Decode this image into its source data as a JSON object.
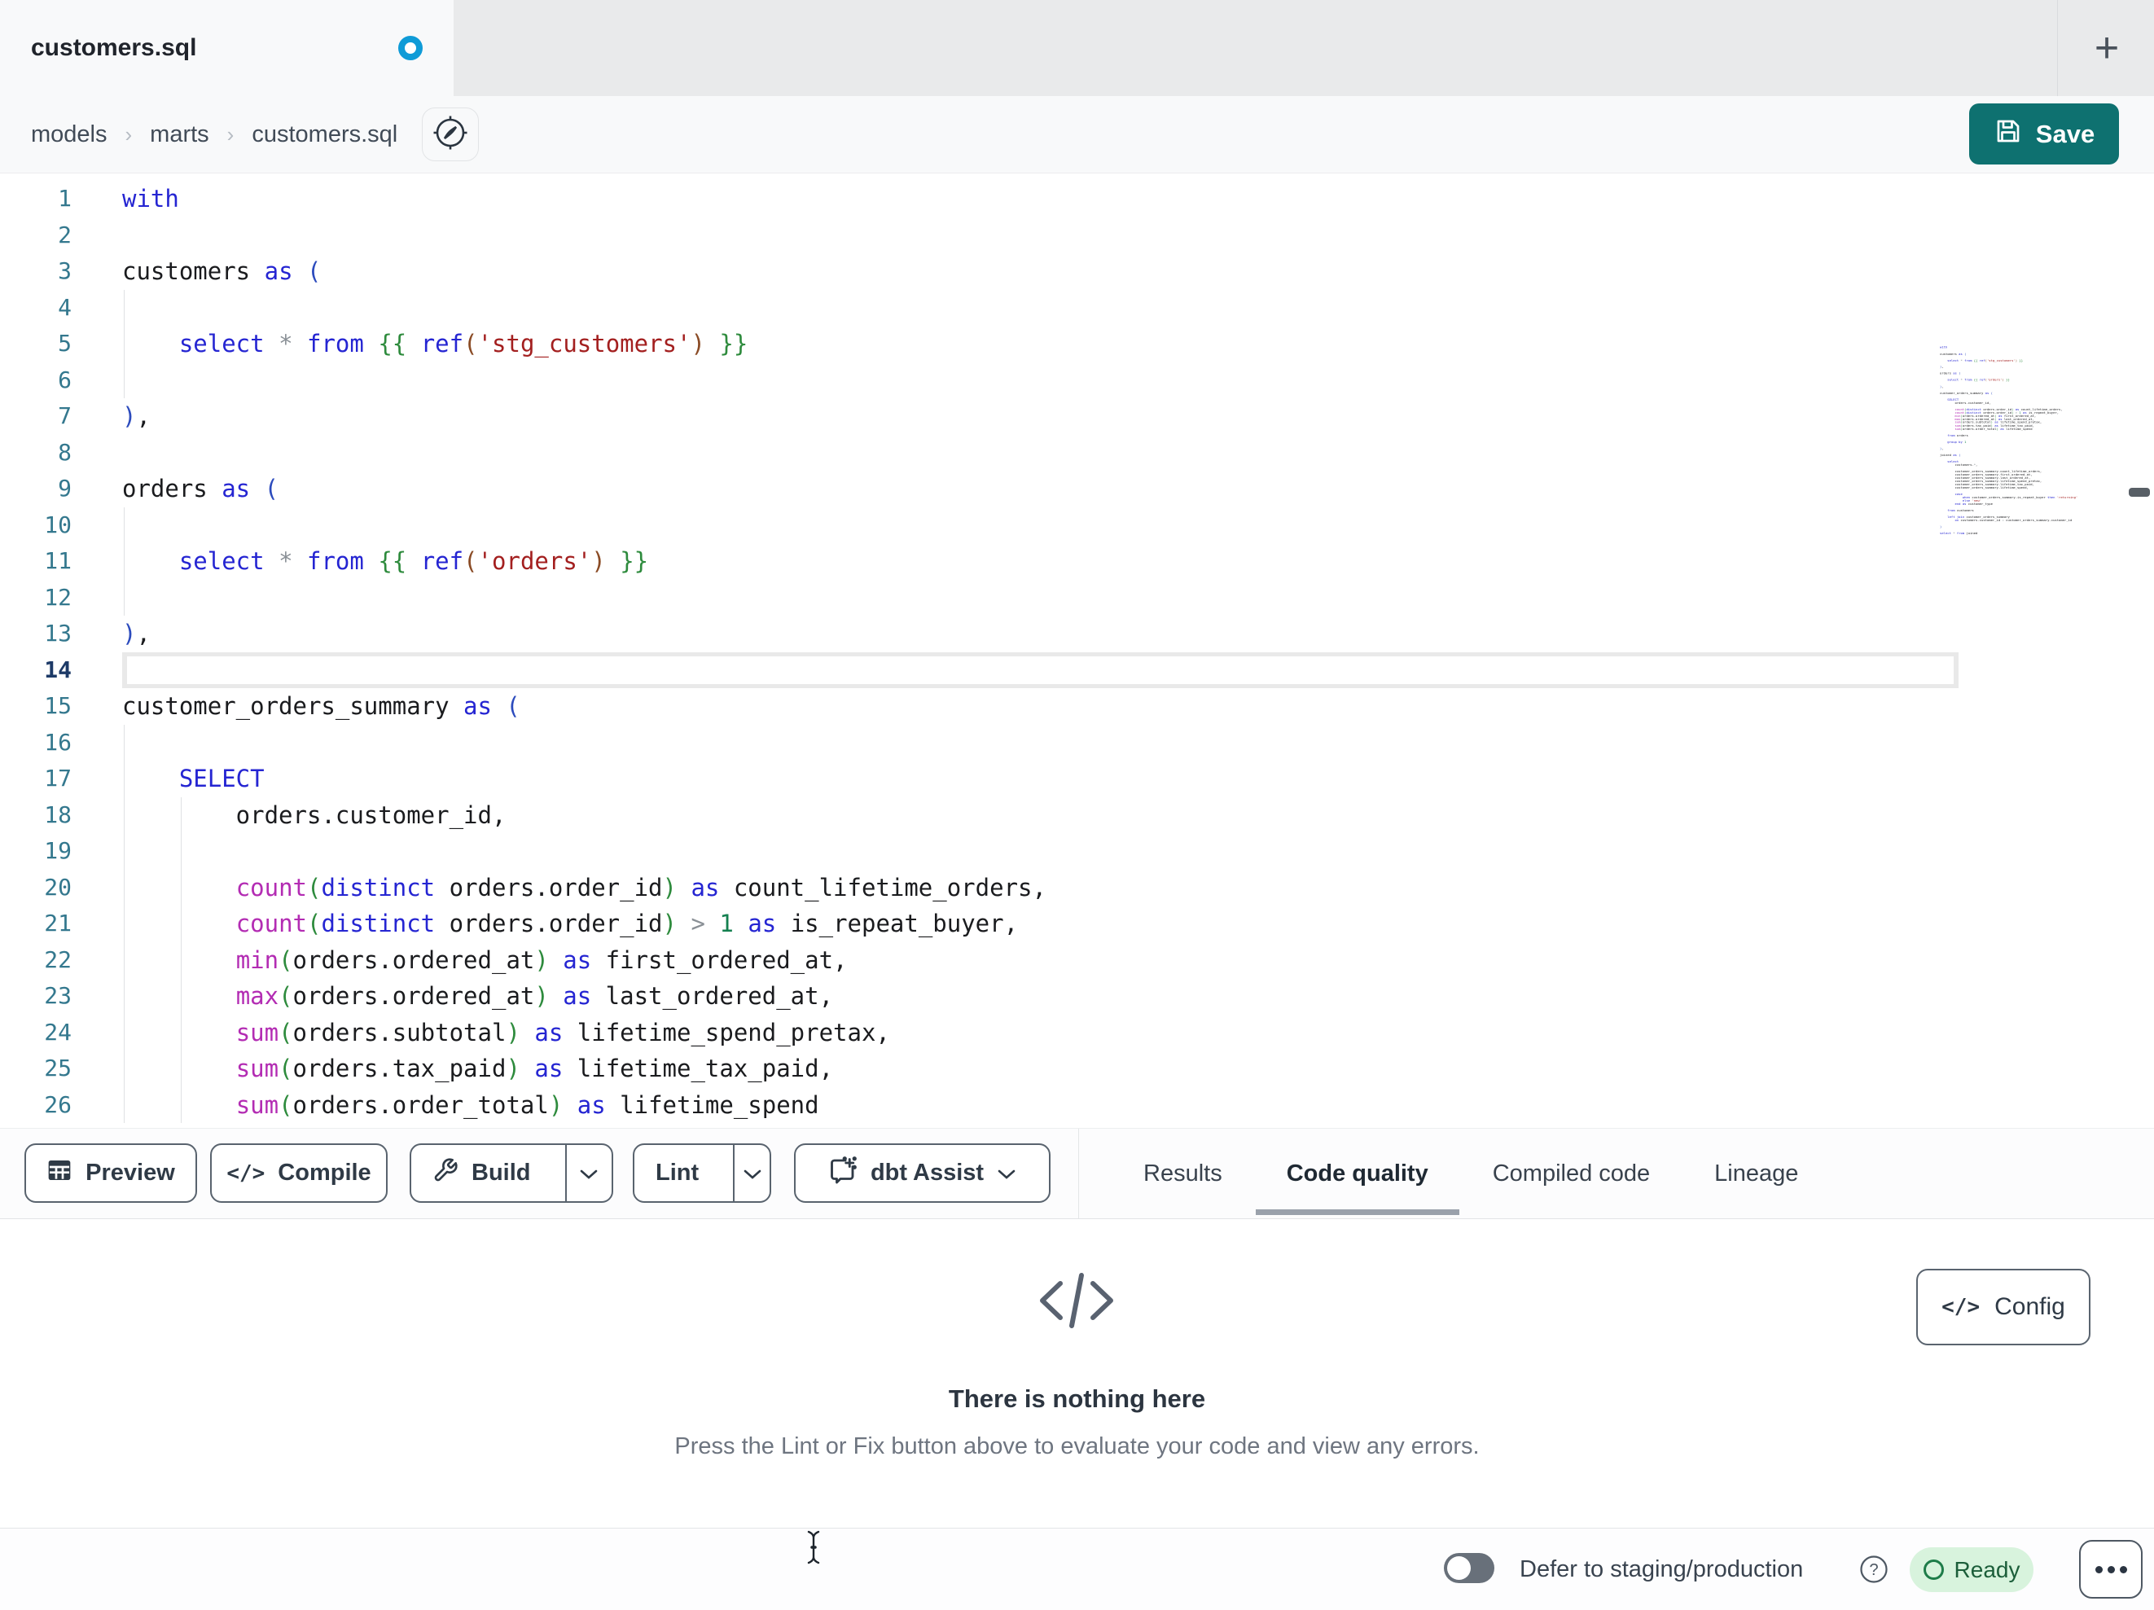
{
  "window": {
    "tab_title": "customers.sql",
    "new_tab_label": "+"
  },
  "breadcrumb": {
    "items": [
      "models",
      "marts",
      "customers.sql"
    ],
    "separator": "›"
  },
  "save": {
    "label": "Save"
  },
  "colors": {
    "accent_teal": "#0e7170",
    "modified_dot_blue": "#0f9bd7",
    "ready_green_bg": "#d8f3dd",
    "ready_green": "#1e7c49"
  },
  "editor": {
    "lines": [
      {
        "n": 1,
        "g": 0,
        "t": [
          [
            "kw",
            "with"
          ]
        ]
      },
      {
        "n": 2,
        "g": 0,
        "t": []
      },
      {
        "n": 3,
        "g": 0,
        "t": [
          [
            "tx",
            "customers "
          ],
          [
            "kw",
            "as"
          ],
          [
            "tx",
            " "
          ],
          [
            "pn",
            "("
          ]
        ]
      },
      {
        "n": 4,
        "g": 1,
        "t": []
      },
      {
        "n": 5,
        "g": 1,
        "t": [
          [
            "tx",
            "    "
          ],
          [
            "kw",
            "select"
          ],
          [
            "tx",
            " "
          ],
          [
            "op",
            "*"
          ],
          [
            "tx",
            " "
          ],
          [
            "kw",
            "from"
          ],
          [
            "tx",
            " "
          ],
          [
            "jj",
            "{{"
          ],
          [
            "tx",
            " "
          ],
          [
            "kw",
            "ref"
          ],
          [
            "pb",
            "("
          ],
          [
            "str",
            "'stg_customers'"
          ],
          [
            "pb",
            ")"
          ],
          [
            "tx",
            " "
          ],
          [
            "jj",
            "}}"
          ]
        ]
      },
      {
        "n": 6,
        "g": 1,
        "t": []
      },
      {
        "n": 7,
        "g": 0,
        "t": [
          [
            "pn",
            ")"
          ],
          [
            "tx",
            ","
          ]
        ]
      },
      {
        "n": 8,
        "g": 0,
        "t": []
      },
      {
        "n": 9,
        "g": 0,
        "t": [
          [
            "tx",
            "orders "
          ],
          [
            "kw",
            "as"
          ],
          [
            "tx",
            " "
          ],
          [
            "pn",
            "("
          ]
        ]
      },
      {
        "n": 10,
        "g": 1,
        "t": []
      },
      {
        "n": 11,
        "g": 1,
        "t": [
          [
            "tx",
            "    "
          ],
          [
            "kw",
            "select"
          ],
          [
            "tx",
            " "
          ],
          [
            "op",
            "*"
          ],
          [
            "tx",
            " "
          ],
          [
            "kw",
            "from"
          ],
          [
            "tx",
            " "
          ],
          [
            "jj",
            "{{"
          ],
          [
            "tx",
            " "
          ],
          [
            "kw",
            "ref"
          ],
          [
            "pb",
            "("
          ],
          [
            "str",
            "'orders'"
          ],
          [
            "pb",
            ")"
          ],
          [
            "tx",
            " "
          ],
          [
            "jj",
            "}}"
          ]
        ]
      },
      {
        "n": 12,
        "g": 1,
        "t": []
      },
      {
        "n": 13,
        "g": 0,
        "t": [
          [
            "pn",
            ")"
          ],
          [
            "tx",
            ","
          ]
        ]
      },
      {
        "n": 14,
        "g": 0,
        "a": true,
        "t": []
      },
      {
        "n": 15,
        "g": 0,
        "t": [
          [
            "tx",
            "customer_orders_summary "
          ],
          [
            "kw",
            "as"
          ],
          [
            "tx",
            " "
          ],
          [
            "pn",
            "("
          ]
        ]
      },
      {
        "n": 16,
        "g": 1,
        "t": []
      },
      {
        "n": 17,
        "g": 1,
        "t": [
          [
            "tx",
            "    "
          ],
          [
            "kw",
            "SELECT"
          ]
        ]
      },
      {
        "n": 18,
        "g": 2,
        "t": [
          [
            "tx",
            "        orders.customer_id,"
          ]
        ]
      },
      {
        "n": 19,
        "g": 2,
        "t": []
      },
      {
        "n": 20,
        "g": 2,
        "t": [
          [
            "tx",
            "        "
          ],
          [
            "fn",
            "count"
          ],
          [
            "pg",
            "("
          ],
          [
            "kw",
            "distinct"
          ],
          [
            "tx",
            " orders.order_id"
          ],
          [
            "pg",
            ")"
          ],
          [
            "tx",
            " "
          ],
          [
            "kw",
            "as"
          ],
          [
            "tx",
            " count_lifetime_orders,"
          ]
        ]
      },
      {
        "n": 21,
        "g": 2,
        "t": [
          [
            "tx",
            "        "
          ],
          [
            "fn",
            "count"
          ],
          [
            "pg",
            "("
          ],
          [
            "kw",
            "distinct"
          ],
          [
            "tx",
            " orders.order_id"
          ],
          [
            "pg",
            ")"
          ],
          [
            "tx",
            " "
          ],
          [
            "op",
            ">"
          ],
          [
            "tx",
            " "
          ],
          [
            "nm",
            "1"
          ],
          [
            "tx",
            " "
          ],
          [
            "kw",
            "as"
          ],
          [
            "tx",
            " is_repeat_buyer,"
          ]
        ]
      },
      {
        "n": 22,
        "g": 2,
        "t": [
          [
            "tx",
            "        "
          ],
          [
            "fn",
            "min"
          ],
          [
            "pg",
            "("
          ],
          [
            "tx",
            "orders.ordered_at"
          ],
          [
            "pg",
            ")"
          ],
          [
            "tx",
            " "
          ],
          [
            "kw",
            "as"
          ],
          [
            "tx",
            " first_ordered_at,"
          ]
        ]
      },
      {
        "n": 23,
        "g": 2,
        "t": [
          [
            "tx",
            "        "
          ],
          [
            "fn",
            "max"
          ],
          [
            "pg",
            "("
          ],
          [
            "tx",
            "orders.ordered_at"
          ],
          [
            "pg",
            ")"
          ],
          [
            "tx",
            " "
          ],
          [
            "kw",
            "as"
          ],
          [
            "tx",
            " last_ordered_at,"
          ]
        ]
      },
      {
        "n": 24,
        "g": 2,
        "t": [
          [
            "tx",
            "        "
          ],
          [
            "fn",
            "sum"
          ],
          [
            "pg",
            "("
          ],
          [
            "tx",
            "orders.subtotal"
          ],
          [
            "pg",
            ")"
          ],
          [
            "tx",
            " "
          ],
          [
            "kw",
            "as"
          ],
          [
            "tx",
            " lifetime_spend_pretax,"
          ]
        ]
      },
      {
        "n": 25,
        "g": 2,
        "t": [
          [
            "tx",
            "        "
          ],
          [
            "fn",
            "sum"
          ],
          [
            "pg",
            "("
          ],
          [
            "tx",
            "orders.tax_paid"
          ],
          [
            "pg",
            ")"
          ],
          [
            "tx",
            " "
          ],
          [
            "kw",
            "as"
          ],
          [
            "tx",
            " lifetime_tax_paid,"
          ]
        ]
      },
      {
        "n": 26,
        "g": 2,
        "t": [
          [
            "tx",
            "        "
          ],
          [
            "fn",
            "sum"
          ],
          [
            "pg",
            "("
          ],
          [
            "tx",
            "orders.order_total"
          ],
          [
            "pg",
            ")"
          ],
          [
            "tx",
            " "
          ],
          [
            "kw",
            "as"
          ],
          [
            "tx",
            " lifetime_spend"
          ]
        ]
      }
    ],
    "minimap_extra": [
      {
        "t": []
      },
      {
        "t": [
          [
            "tx",
            "    "
          ],
          [
            "kw",
            "from"
          ],
          [
            "tx",
            " orders"
          ]
        ]
      },
      {
        "t": []
      },
      {
        "t": [
          [
            "tx",
            "    "
          ],
          [
            "kw",
            "group by"
          ],
          [
            "tx",
            " "
          ],
          [
            "nm",
            "1"
          ]
        ]
      },
      {
        "t": []
      },
      {
        "t": [
          [
            "pn",
            ")"
          ],
          [
            "tx",
            ","
          ]
        ]
      },
      {
        "t": []
      },
      {
        "t": [
          [
            "tx",
            "joined "
          ],
          [
            "kw",
            "as"
          ],
          [
            "tx",
            " "
          ],
          [
            "pn",
            "("
          ]
        ]
      },
      {
        "t": []
      },
      {
        "t": [
          [
            "tx",
            "    "
          ],
          [
            "kw",
            "select"
          ]
        ]
      },
      {
        "t": [
          [
            "tx",
            "        customers."
          ],
          [
            "op",
            "*"
          ],
          [
            "tx",
            ","
          ]
        ]
      },
      {
        "t": []
      },
      {
        "t": [
          [
            "tx",
            "        customer_orders_summary.count_lifetime_orders,"
          ]
        ]
      },
      {
        "t": [
          [
            "tx",
            "        customer_orders_summary.first_ordered_at,"
          ]
        ]
      },
      {
        "t": [
          [
            "tx",
            "        customer_orders_summary.last_ordered_at,"
          ]
        ]
      },
      {
        "t": [
          [
            "tx",
            "        customer_orders_summary.lifetime_spend_pretax,"
          ]
        ]
      },
      {
        "t": [
          [
            "tx",
            "        customer_orders_summary.lifetime_tax_paid,"
          ]
        ]
      },
      {
        "t": [
          [
            "tx",
            "        customer_orders_summary.lifetime_spend,"
          ]
        ]
      },
      {
        "t": []
      },
      {
        "t": [
          [
            "tx",
            "        "
          ],
          [
            "kw",
            "case"
          ]
        ]
      },
      {
        "t": [
          [
            "tx",
            "            "
          ],
          [
            "kw",
            "when"
          ],
          [
            "tx",
            " customer_orders_summary.is_repeat_buyer "
          ],
          [
            "kw",
            "then"
          ],
          [
            "tx",
            " "
          ],
          [
            "str",
            "'returning'"
          ]
        ]
      },
      {
        "t": [
          [
            "tx",
            "            "
          ],
          [
            "kw",
            "else"
          ],
          [
            "tx",
            " "
          ],
          [
            "str",
            "'new'"
          ]
        ]
      },
      {
        "t": [
          [
            "tx",
            "        "
          ],
          [
            "kw",
            "end"
          ],
          [
            "tx",
            " "
          ],
          [
            "kw",
            "as"
          ],
          [
            "tx",
            " customer_type"
          ]
        ]
      },
      {
        "t": []
      },
      {
        "t": [
          [
            "tx",
            "    "
          ],
          [
            "kw",
            "from"
          ],
          [
            "tx",
            " customers"
          ]
        ]
      },
      {
        "t": []
      },
      {
        "t": [
          [
            "tx",
            "    "
          ],
          [
            "kw",
            "left join"
          ],
          [
            "tx",
            " customer_orders_summary"
          ]
        ]
      },
      {
        "t": [
          [
            "tx",
            "        "
          ],
          [
            "kw",
            "on"
          ],
          [
            "tx",
            " customers.customer_id "
          ],
          [
            "op",
            "="
          ],
          [
            "tx",
            " customer_orders_summary.customer_id"
          ]
        ]
      },
      {
        "t": []
      },
      {
        "t": [
          [
            "pn",
            ")"
          ]
        ]
      },
      {
        "t": []
      },
      {
        "t": [
          [
            "kw",
            "select"
          ],
          [
            "tx",
            " "
          ],
          [
            "op",
            "*"
          ],
          [
            "tx",
            " "
          ],
          [
            "kw",
            "from"
          ],
          [
            "tx",
            " joined"
          ]
        ]
      }
    ]
  },
  "toolbar": {
    "preview_label": "Preview",
    "compile_label": "Compile",
    "build_label": "Build",
    "lint_label": "Lint",
    "assist_label": "dbt Assist"
  },
  "result_tabs": [
    {
      "label": "Results",
      "active": false
    },
    {
      "label": "Code quality",
      "active": true
    },
    {
      "label": "Compiled code",
      "active": false
    },
    {
      "label": "Lineage",
      "active": false
    }
  ],
  "empty_state": {
    "title": "There is nothing here",
    "subtitle": "Press the Lint or Fix button above to evaluate your code and view any errors."
  },
  "config": {
    "label": "Config"
  },
  "bottombar": {
    "defer_label": "Defer to staging/production",
    "status": "Ready"
  }
}
